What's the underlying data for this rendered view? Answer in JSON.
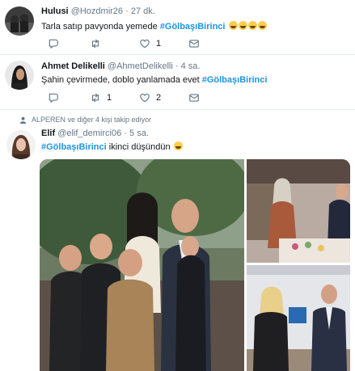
{
  "tweets": [
    {
      "name": "Hulusi",
      "handle": "@Hozdmir26",
      "dot": "·",
      "time": "27 dk.",
      "text_plain": "Tarla satıp pavyonda yemede  ",
      "hashtag": "#GölbaşıBirinci",
      "emojis": [
        "grinning-sweat",
        "grinning-sweat",
        "grinning-sweat",
        "grinning"
      ],
      "reply_count": "",
      "retweet_count": "",
      "like_count": "1",
      "dm_label": ""
    },
    {
      "name": "Ahmet Delikelli",
      "handle": "@AhmetDelikelli",
      "dot": "·",
      "time": "4 sa.",
      "text_plain": "Şahin çevirmede, doblo yanlamada evet ",
      "hashtag": "#GölbaşıBirinci",
      "emojis": [],
      "reply_count": "",
      "retweet_count": "1",
      "like_count": "2",
      "dm_label": ""
    },
    {
      "social_context": "ALPEREN ve diğer 4 kişi takip ediyor",
      "name": "Elif",
      "handle": "@elif_demirci06",
      "dot": "·",
      "time": "5 sa.",
      "hashtag": "#GölbaşıBirinci",
      "text_after": " ikinci düşündün ",
      "emojis": [
        "grimacing"
      ]
    }
  ],
  "colors": {
    "text": "#14171a",
    "secondary": "#657786",
    "link": "#1b95e0",
    "border": "#e6ecf0"
  }
}
